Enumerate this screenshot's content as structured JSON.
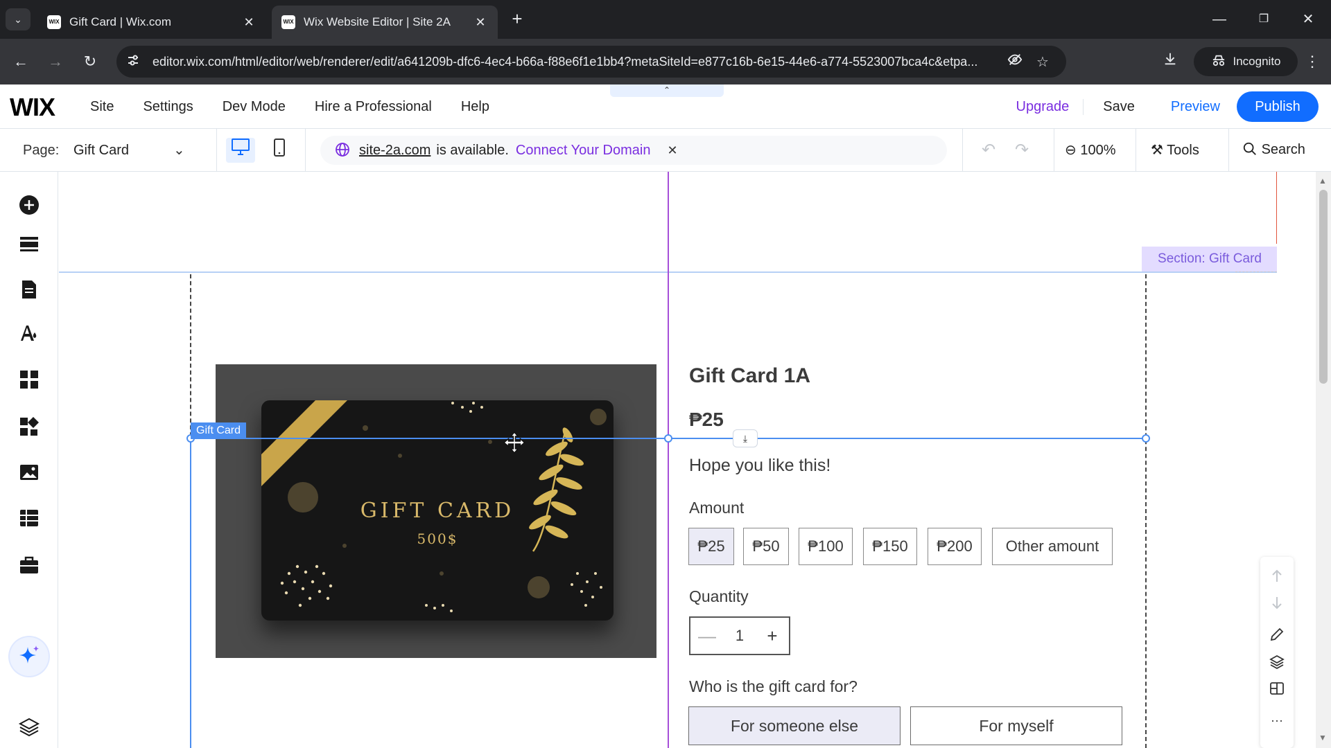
{
  "browser": {
    "tabs": [
      {
        "title": "Gift Card | Wix.com",
        "favicon": "WIX",
        "active": false
      },
      {
        "title": "Wix Website Editor | Site 2A",
        "favicon": "WIX",
        "active": true
      }
    ],
    "url": "editor.wix.com/html/editor/web/renderer/edit/a641209b-dfc6-4ec4-b66a-f88e6f1e1bb4?metaSiteId=e877c16b-6e15-44e6-a774-5523007bca4c&etpa...",
    "incognito_label": "Incognito"
  },
  "wix": {
    "logo": "WIX",
    "menu": [
      "Site",
      "Settings",
      "Dev Mode",
      "Hire a Professional",
      "Help"
    ],
    "upgrade": "Upgrade",
    "save": "Save",
    "preview": "Preview",
    "publish": "Publish",
    "accent_color": "#116dff",
    "upgrade_color": "#7a2ee0"
  },
  "toolbar": {
    "page_label": "Page:",
    "page_name": "Gift Card",
    "domain": "site-2a.com",
    "domain_status": "is available.",
    "connect": "Connect Your Domain",
    "zoom": "100%",
    "tools": "Tools",
    "search": "Search"
  },
  "canvas": {
    "section_label": "Section: Gift Card",
    "element_tag": "Gift Card",
    "image": {
      "title": "GIFT CARD",
      "subtitle": "500$"
    },
    "product": {
      "title": "Gift Card 1A",
      "price": "₱25",
      "description": "Hope you like this!",
      "amount_label": "Amount",
      "amounts": [
        "₱25",
        "₱50",
        "₱100",
        "₱150",
        "₱200",
        "Other amount"
      ],
      "selected_amount_index": 0,
      "quantity_label": "Quantity",
      "quantity": "1",
      "who_label": "Who is the gift card for?",
      "recipient_options": [
        "For someone else",
        "For myself"
      ],
      "selected_recipient_index": 0
    }
  }
}
